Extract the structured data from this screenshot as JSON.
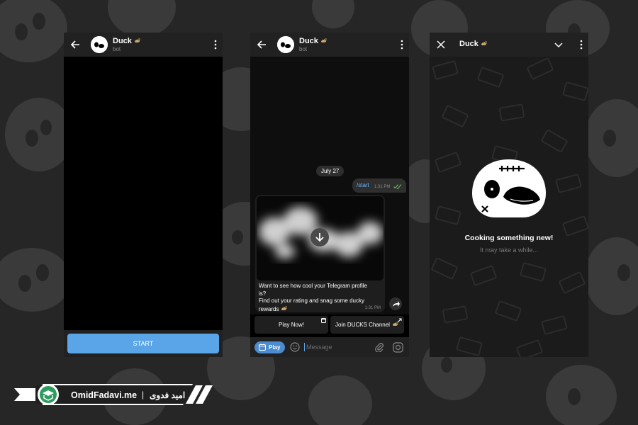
{
  "phone1": {
    "header": {
      "name": "Duck",
      "subtitle": "bot"
    },
    "start_label": "START"
  },
  "phone2": {
    "header": {
      "name": "Duck",
      "subtitle": "bot"
    },
    "date_chip": "July 27",
    "outgoing": {
      "text": "/start",
      "time": "1:31 PM"
    },
    "message": {
      "lines": [
        "Want to see how cool your Telegram profile",
        "is?",
        "Find out your rating and snag some ducky",
        "rewards"
      ],
      "time": "1:31 PM"
    },
    "keyboard": {
      "play_now": "Play Now!",
      "join_channel": "Join DUCKS Channel"
    },
    "input": {
      "play_label": "Play",
      "placeholder": "Message"
    }
  },
  "phone3": {
    "title": "Duck",
    "cooking": "Cooking something new!",
    "wait": "It may take a while..."
  },
  "brand": {
    "site": "OmidFadavi.me",
    "separator": "|",
    "name": "امید فدوی"
  },
  "colors": {
    "accent": "#5aa5e7",
    "link": "#68b4ff",
    "background": "#262626",
    "check": "#5fbf5f"
  }
}
